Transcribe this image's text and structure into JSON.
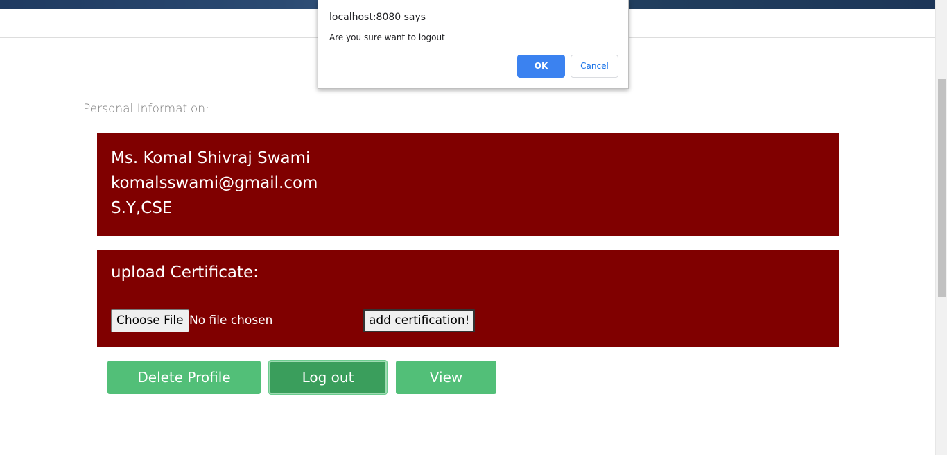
{
  "personal_section": {
    "label": "Personal Information:",
    "name": "Ms. Komal Shivraj Swami",
    "email": "komalsswami@gmail.com",
    "class": "S.Y,CSE"
  },
  "upload_section": {
    "title": "upload Certificate:",
    "choose_file_label": "Choose File",
    "file_status": "No file chosen",
    "submit_label": "add certification!"
  },
  "actions": {
    "delete_label": "Delete Profile",
    "logout_label": "Log out",
    "view_label": "View"
  },
  "dialog": {
    "title": "localhost:8080 says",
    "message": "Are you sure want to logout",
    "ok_label": "OK",
    "cancel_label": "Cancel"
  },
  "colors": {
    "panel_bg": "#800000",
    "action_green": "#52bf78",
    "dialog_ok_blue": "#3b82f0"
  }
}
